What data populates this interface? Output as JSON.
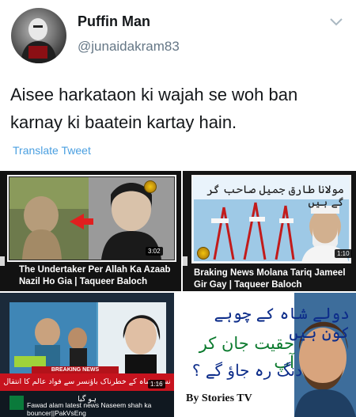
{
  "author": {
    "name": "Puffin Man",
    "handle": "@junaidakram83"
  },
  "tweet": {
    "text": "Aisee harkataon ki wajah se woh ban karnay ki baatein kartay hain.",
    "translate_label": "Translate Tweet"
  },
  "media": [
    {
      "title": "The Undertaker Per Allah Ka Azaab Nazil Ho Gia | Taqueer Baloch",
      "duration": "3:02",
      "icon": "play-thumbnail"
    },
    {
      "title": "Braking News Molana Tariq Jameel Gir Gay | Taqueer Baloch",
      "overlay_text": "مولانا طارق جمیل صاحب گر گے ہیں",
      "duration": "1:10"
    },
    {
      "title": "Fawad alam latest news Naseem shah ka bouncer||PakVsEng",
      "breaking_label": "BREAKING NEWS",
      "band_text": "نسیم شاہ کے خطرناک باؤنسر سے فواد عالم کا انتقال ہو گیا",
      "duration": "1:16"
    },
    {
      "line1": "دولے شاہ کے چوہے کون ہیں",
      "line2": "حقیت جان کر آپ",
      "line3": "دنگ رہ جاؤ گے ؟",
      "brand": "By Stories TV"
    }
  ],
  "colors": {
    "link": "#4a9fe0",
    "handle": "#657786",
    "text": "#14171a",
    "breaking_red": "#c7131e"
  }
}
